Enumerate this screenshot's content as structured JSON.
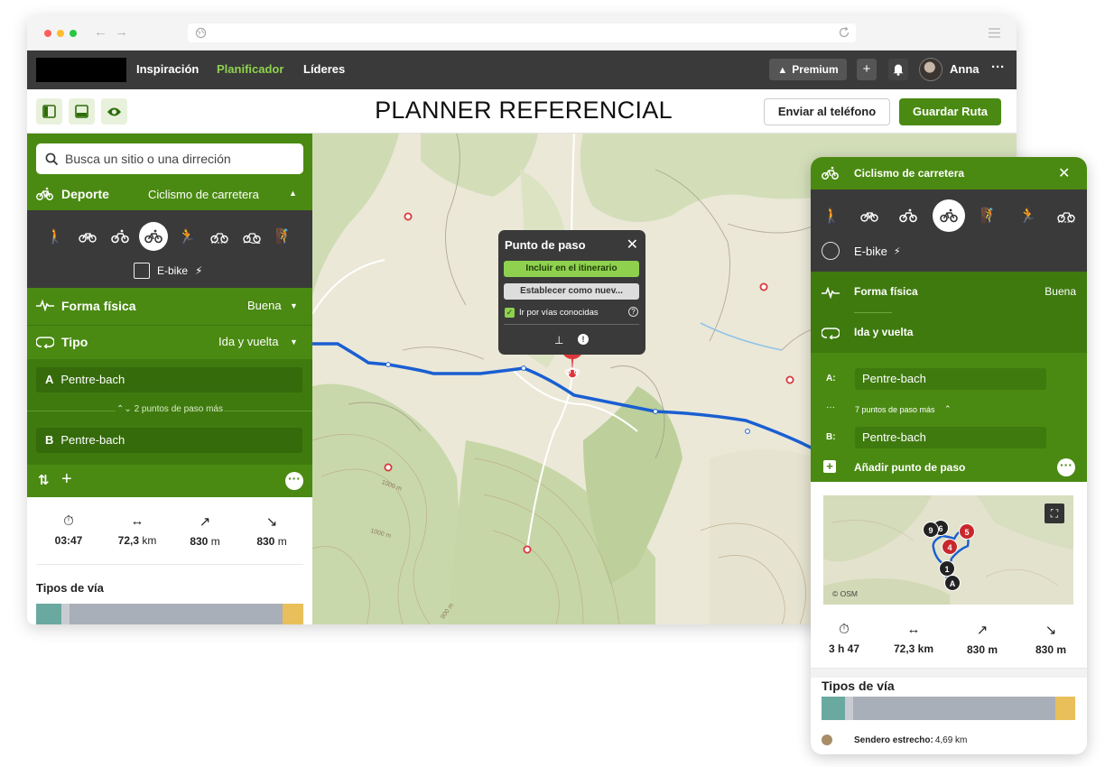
{
  "nav": {
    "inspiracion": "Inspiración",
    "planificador": "Planificador",
    "lideres": "Líderes",
    "premium": "Premium",
    "user": "Anna",
    "more": "···"
  },
  "toolbar": {
    "title": "PLANNER REFERENCIAL",
    "send": "Enviar al teléfono",
    "save": "Guardar Ruta"
  },
  "sidebar": {
    "search_placeholder": "Busca un sitio o una dirreción",
    "sport_label": "Deporte",
    "sport_value": "Ciclismo de carretera",
    "ebike": "E-bike",
    "fitness_label": "Forma física",
    "fitness_value": "Buena",
    "type_label": "Tipo",
    "type_value": "Ida y vuelta",
    "wp_a_letter": "A",
    "wp_a": "Pentre-bach",
    "more_waypoints": "⌃⌄ 2 puntos de paso más",
    "wp_b_letter": "B",
    "wp_b": "Pentre-bach",
    "stats": {
      "time": "03:47",
      "distance": "72,3",
      "distance_unit": "km",
      "up": "830",
      "up_unit": "m",
      "down": "830",
      "down_unit": "m"
    },
    "road_types": "Tipos de vía"
  },
  "popup": {
    "title": "Punto de paso",
    "include": "Incluir en el itinerario",
    "set_as": "Establecer como nuev...",
    "known_roads": "Ir por vías conocidas"
  },
  "map": {
    "contour_labels": [
      "1000 m",
      "1000 m",
      "900 m"
    ]
  },
  "phone": {
    "sport": "Ciclismo de carretera",
    "ebike": "E-bike",
    "fitness_label": "Forma física",
    "fitness_value": "Buena",
    "type_label": "Ida y vuelta",
    "a_label": "A:",
    "a_value": "Pentre-bach",
    "more": "7 puntos de paso más",
    "b_label": "B:",
    "b_value": "Pentre-bach",
    "add_waypoint": "Añadir punto de paso",
    "minimap_pins": [
      "6",
      "9",
      "5",
      "4",
      "1",
      "A"
    ],
    "osm": "© OSM",
    "stats": {
      "time": "3 h 47",
      "distance": "72,3 km",
      "up": "830 m",
      "down": "830 m"
    },
    "road_types": "Tipos de vía",
    "legend_label": "Sendero estrecho:",
    "legend_value": "4,69 km"
  },
  "colors": {
    "brand_green": "#4a8a12",
    "dark_green": "#3f7a0f",
    "route_blue": "#1a5fd1",
    "dark_panel": "#3a3a3a"
  }
}
